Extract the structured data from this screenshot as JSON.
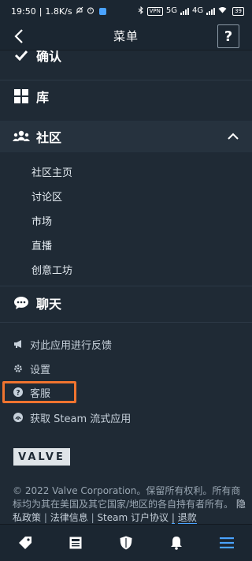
{
  "status_bar": {
    "time": "19:50",
    "network_speed": "1.8K/s",
    "vpn_label": "VPN",
    "signal_label_1": "5G",
    "signal_label_2": "4G",
    "battery": "39"
  },
  "header": {
    "title": "菜单",
    "help_label": "?"
  },
  "menu": {
    "confirm_label": "确认",
    "library_label": "库",
    "community": {
      "label": "社区",
      "items": [
        "社区主页",
        "讨论区",
        "市场",
        "直播",
        "创意工坊"
      ]
    },
    "chat_label": "聊天",
    "secondary_items": [
      {
        "label": "对此应用进行反馈",
        "icon": "megaphone-icon"
      },
      {
        "label": "设置",
        "icon": "gear-icon"
      },
      {
        "label": "客服",
        "icon": "help-circle-icon"
      },
      {
        "label": "获取 Steam 流式应用",
        "icon": "steam-link-icon"
      }
    ]
  },
  "logo": {
    "text": "VALVE"
  },
  "footer": {
    "copyright": "© 2022 Valve Corporation。保留所有权利。所有商标均为其在美国及其它国家/地区的各自持有者所有。",
    "privacy": "隐私政策",
    "legal": "法律信息",
    "ssa": "Steam 订户协议",
    "refunds": "退款",
    "separator": "|"
  },
  "tab_bar": {
    "tabs": [
      "store-tag-icon",
      "news-icon",
      "shield-icon",
      "notifications-icon",
      "menu-icon"
    ],
    "active_color": "#4aa3ff"
  },
  "colors": {
    "background": "#1f2a35",
    "highlight": "#f0742f"
  }
}
